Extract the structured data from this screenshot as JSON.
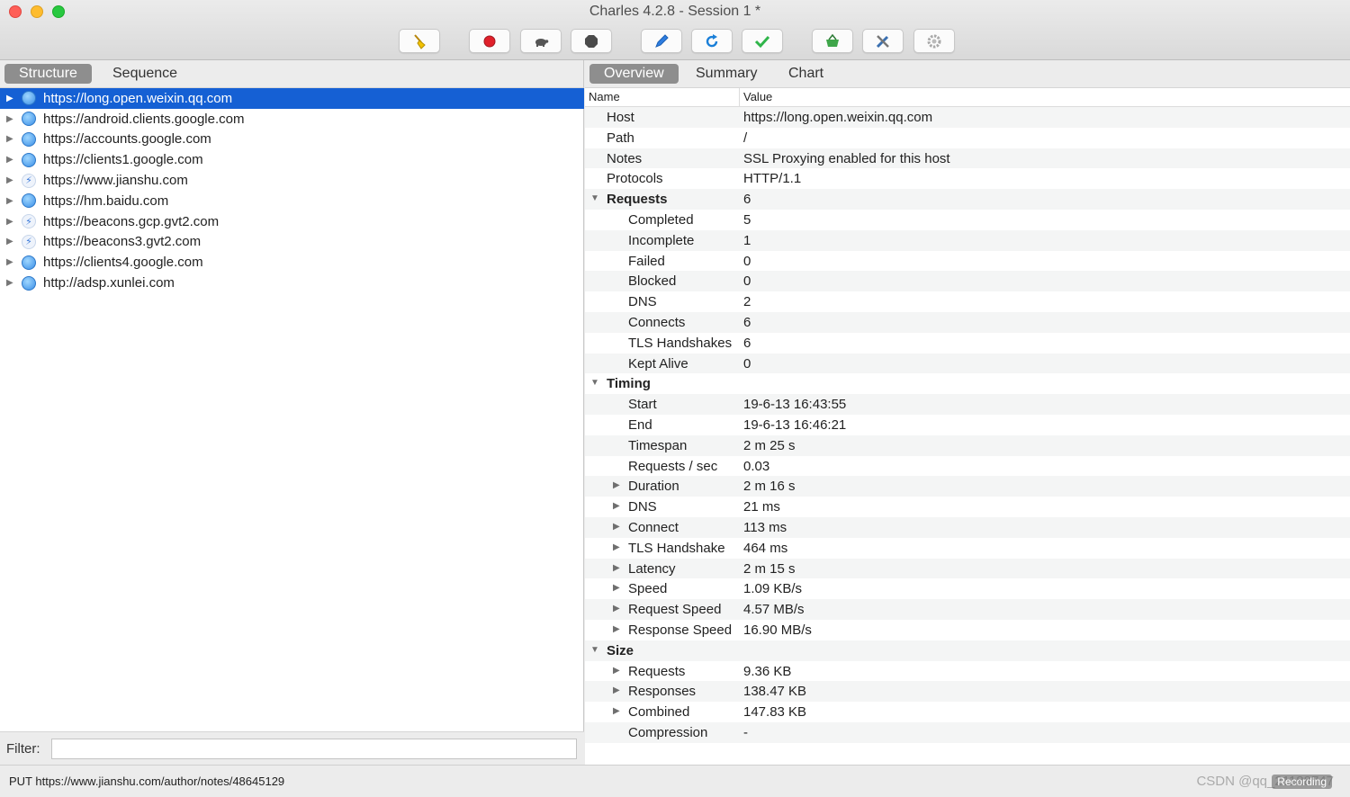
{
  "window": {
    "title": "Charles 4.2.8 - Session 1 *"
  },
  "toolbar": [
    {
      "name": "broom-clear-icon"
    },
    {
      "name": "record-icon"
    },
    {
      "name": "throttle-turtle-icon"
    },
    {
      "name": "breakpoints-icon"
    },
    {
      "name": "compose-pen-icon"
    },
    {
      "name": "repeat-refresh-icon"
    },
    {
      "name": "validate-check-icon"
    },
    {
      "name": "shopping-basket-icon"
    },
    {
      "name": "tools-icon"
    },
    {
      "name": "settings-gear-icon"
    }
  ],
  "left": {
    "tabs": [
      "Structure",
      "Sequence"
    ],
    "hosts": [
      {
        "url": "https://long.open.weixin.qq.com",
        "icon": "globe-icon"
      },
      {
        "url": "https://android.clients.google.com",
        "icon": "globe-icon"
      },
      {
        "url": "https://accounts.google.com",
        "icon": "globe-icon"
      },
      {
        "url": "https://clients1.google.com",
        "icon": "globe-icon"
      },
      {
        "url": "https://www.jianshu.com",
        "icon": "lightning-icon"
      },
      {
        "url": "https://hm.baidu.com",
        "icon": "globe-icon"
      },
      {
        "url": "https://beacons.gcp.gvt2.com",
        "icon": "lightning-icon"
      },
      {
        "url": "https://beacons3.gvt2.com",
        "icon": "lightning-icon"
      },
      {
        "url": "https://clients4.google.com",
        "icon": "globe-icon"
      },
      {
        "url": "http://adsp.xunlei.com",
        "icon": "globe-icon"
      }
    ],
    "filter_label": "Filter:",
    "filter_value": ""
  },
  "right": {
    "tabs": [
      "Overview",
      "Summary",
      "Chart"
    ],
    "col_name": "Name",
    "col_value": "Value",
    "rows": [
      {
        "name": "Host",
        "value": "https://long.open.weixin.qq.com",
        "level": 0
      },
      {
        "name": "Path",
        "value": "/",
        "level": 0
      },
      {
        "name": "Notes",
        "value": "SSL Proxying enabled for this host",
        "level": 0
      },
      {
        "name": "Protocols",
        "value": "HTTP/1.1",
        "level": 0
      },
      {
        "name": "Requests",
        "value": "6",
        "level": 0,
        "group": true,
        "expanded": true
      },
      {
        "name": "Completed",
        "value": "5",
        "level": 1
      },
      {
        "name": "Incomplete",
        "value": "1",
        "level": 1
      },
      {
        "name": "Failed",
        "value": "0",
        "level": 1
      },
      {
        "name": "Blocked",
        "value": "0",
        "level": 1
      },
      {
        "name": "DNS",
        "value": "2",
        "level": 1
      },
      {
        "name": "Connects",
        "value": "6",
        "level": 1
      },
      {
        "name": "TLS Handshakes",
        "value": "6",
        "level": 1
      },
      {
        "name": "Kept Alive",
        "value": "0",
        "level": 1
      },
      {
        "name": "Timing",
        "value": "",
        "level": 0,
        "group": true,
        "expanded": true
      },
      {
        "name": "Start",
        "value": "19-6-13 16:43:55",
        "level": 1
      },
      {
        "name": "End",
        "value": "19-6-13 16:46:21",
        "level": 1
      },
      {
        "name": "Timespan",
        "value": "2 m 25 s",
        "level": 1
      },
      {
        "name": "Requests / sec",
        "value": "0.03",
        "level": 1
      },
      {
        "name": "Duration",
        "value": "2 m 16 s",
        "level": 1,
        "collapsed": true
      },
      {
        "name": "DNS",
        "value": "21 ms",
        "level": 1,
        "collapsed": true
      },
      {
        "name": "Connect",
        "value": "113 ms",
        "level": 1,
        "collapsed": true
      },
      {
        "name": "TLS Handshake",
        "value": "464 ms",
        "level": 1,
        "collapsed": true
      },
      {
        "name": "Latency",
        "value": "2 m 15 s",
        "level": 1,
        "collapsed": true
      },
      {
        "name": "Speed",
        "value": "1.09 KB/s",
        "level": 1,
        "collapsed": true
      },
      {
        "name": "Request Speed",
        "value": "4.57 MB/s",
        "level": 1,
        "collapsed": true
      },
      {
        "name": "Response Speed",
        "value": "16.90 MB/s",
        "level": 1,
        "collapsed": true
      },
      {
        "name": "Size",
        "value": "",
        "level": 0,
        "group": true,
        "expanded": true
      },
      {
        "name": "Requests",
        "value": "9.36 KB",
        "level": 1,
        "collapsed": true
      },
      {
        "name": "Responses",
        "value": "138.47 KB",
        "level": 1,
        "collapsed": true
      },
      {
        "name": "Combined",
        "value": "147.83 KB",
        "level": 1,
        "collapsed": true
      },
      {
        "name": "Compression",
        "value": "-",
        "level": 1
      }
    ]
  },
  "status": {
    "text": "PUT https://www.jianshu.com/author/notes/48645129",
    "recording": "Recording",
    "watermark": "CSDN @qq_21188747"
  }
}
